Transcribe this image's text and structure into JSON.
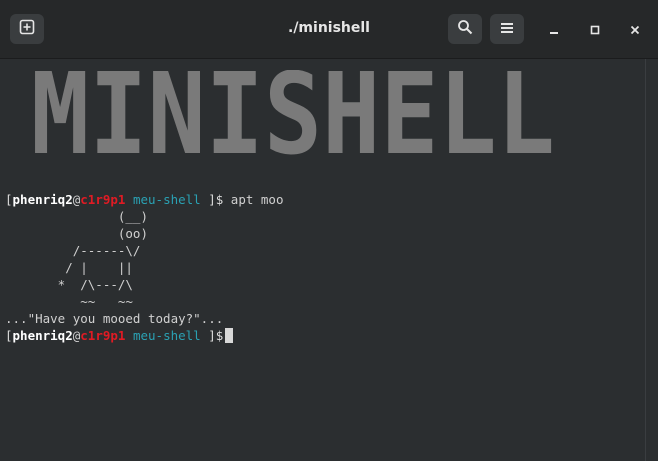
{
  "window": {
    "title": "./minishell"
  },
  "icons": {
    "new_tab": "new-tab-icon",
    "search": "search-icon",
    "menu": "hamburger-menu-icon",
    "minimize": "minimize-icon",
    "maximize": "maximize-icon",
    "close": "close-icon"
  },
  "banner": {
    "text": "MINISHELL"
  },
  "prompt": {
    "open": "[",
    "user": "phenriq2",
    "at": "@",
    "host": "c1r9p1",
    "dir": "meu-shell",
    "close": " ]$"
  },
  "command": " apt moo",
  "cow": [
    "               (__)",
    "               (oo)",
    "         /------\\/",
    "        / |    ||",
    "       *  /\\---/\\",
    "          ~~   ~~"
  ],
  "moo_message": "...\"Have you mooed today?\"...",
  "colors": {
    "background": "#2b2e30",
    "host": "#e01b24",
    "dir": "#2aa1b3"
  }
}
